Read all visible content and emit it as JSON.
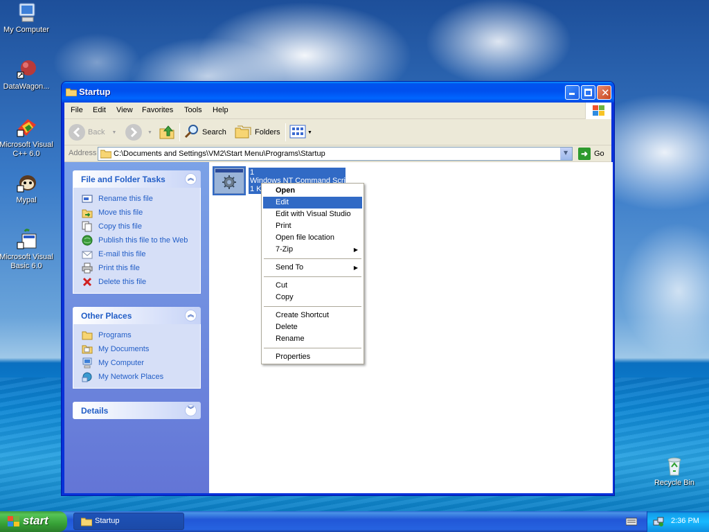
{
  "desktop": {
    "icons": [
      {
        "label": "My Computer"
      },
      {
        "label": "DataWagon..."
      },
      {
        "label": "Microsoft Visual C++ 6.0"
      },
      {
        "label": "Mypal"
      },
      {
        "label": "Microsoft Visual Basic 6.0"
      },
      {
        "label": "Recycle Bin"
      }
    ]
  },
  "window": {
    "title": "Startup",
    "menu": [
      "File",
      "Edit",
      "View",
      "Favorites",
      "Tools",
      "Help"
    ],
    "toolbar": {
      "back": "Back",
      "search": "Search",
      "folders": "Folders"
    },
    "address": {
      "label": "Address",
      "value": "C:\\Documents and Settings\\VM2\\Start Menu\\Programs\\Startup",
      "go": "Go"
    }
  },
  "tasks_panel": {
    "title": "File and Folder Tasks",
    "items": [
      {
        "label": "Rename this file",
        "icon": "rename-icon"
      },
      {
        "label": "Move this file",
        "icon": "move-icon"
      },
      {
        "label": "Copy this file",
        "icon": "copy-icon"
      },
      {
        "label": "Publish this file to the Web",
        "icon": "globe-icon"
      },
      {
        "label": "E-mail this file",
        "icon": "email-icon"
      },
      {
        "label": "Print this file",
        "icon": "printer-icon"
      },
      {
        "label": "Delete this file",
        "icon": "delete-icon"
      }
    ]
  },
  "places_panel": {
    "title": "Other Places",
    "items": [
      {
        "label": "Programs",
        "icon": "folder-icon"
      },
      {
        "label": "My Documents",
        "icon": "documents-icon"
      },
      {
        "label": "My Computer",
        "icon": "computer-icon"
      },
      {
        "label": "My Network Places",
        "icon": "network-icon"
      }
    ]
  },
  "details_panel": {
    "title": "Details"
  },
  "file": {
    "name": "1",
    "type": "Windows NT Command Script",
    "size": "1 KB"
  },
  "context_menu": {
    "items": [
      "Open",
      "Edit",
      "Edit with Visual Studio",
      "Print",
      "Open file location",
      "7-Zip",
      "Send To",
      "Cut",
      "Copy",
      "Create Shortcut",
      "Delete",
      "Rename",
      "Properties"
    ],
    "selected": "Edit"
  },
  "taskbar": {
    "start": "start",
    "task": "Startup",
    "clock": "2:36 PM"
  },
  "colors": {
    "selection": "#316ac5",
    "link": "#215dc6",
    "title_blue": "#0053ee"
  }
}
